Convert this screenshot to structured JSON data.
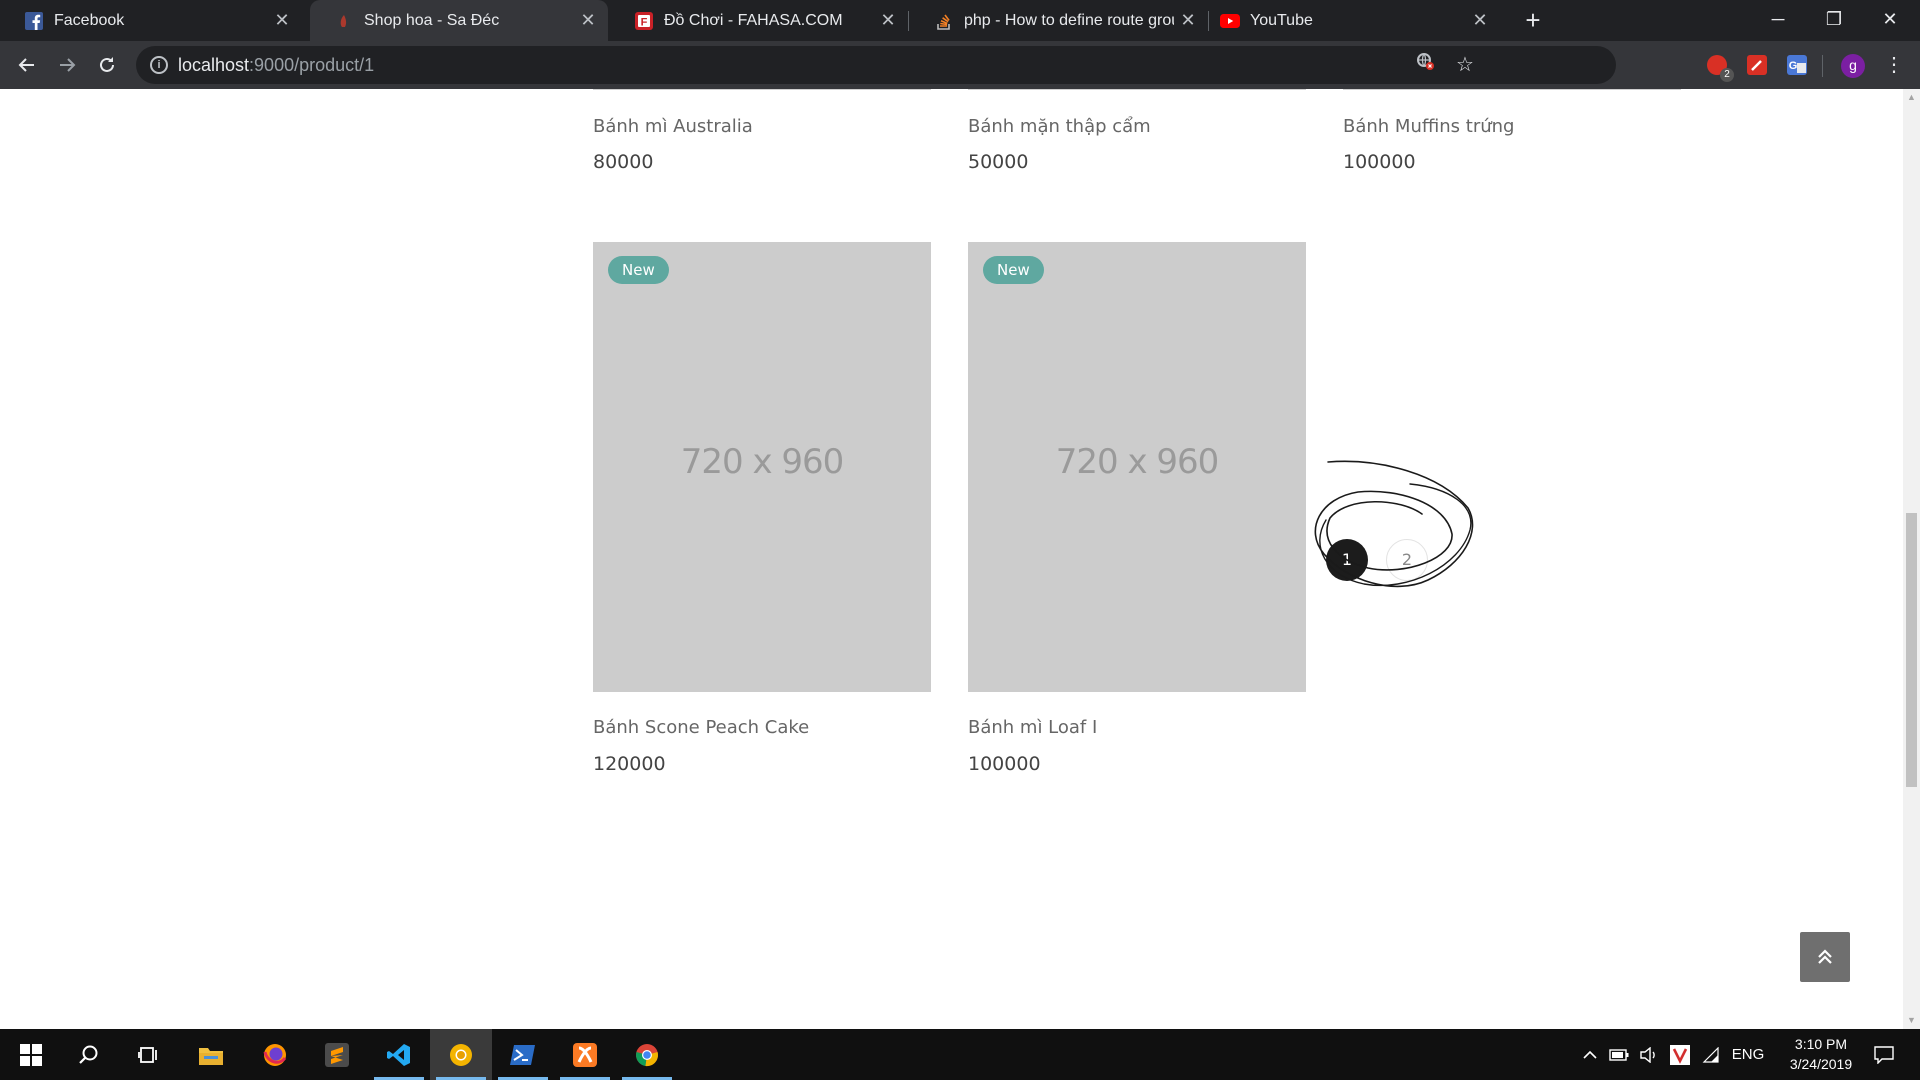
{
  "browser": {
    "tabs": [
      {
        "title": "Facebook",
        "icon": "facebook-icon",
        "active": false
      },
      {
        "title": "Shop hoa - Sa Đéc",
        "icon": "site-icon",
        "active": true
      },
      {
        "title": "Đồ Chơi - FAHASA.COM",
        "icon": "fahasa-icon",
        "active": false
      },
      {
        "title": "php - How to define route group",
        "icon": "stackoverflow-icon",
        "active": false
      },
      {
        "title": "YouTube",
        "icon": "youtube-icon",
        "active": false
      }
    ],
    "url_host": "localhost",
    "url_rest": ":9000/product/1",
    "extension_badge": "2",
    "profile_initial": "g"
  },
  "products_top": [
    {
      "name": "Bánh mì Australia",
      "price": "80000"
    },
    {
      "name": "Bánh mặn thập cẩm",
      "price": "50000"
    },
    {
      "name": "Bánh Muffins trứng",
      "price": "100000"
    }
  ],
  "products": [
    {
      "badge": "New",
      "image_text": "720 x 960",
      "name": "Bánh Scone Peach Cake",
      "price": "120000"
    },
    {
      "badge": "New",
      "image_text": "720 x 960",
      "name": "Bánh mì Loaf I",
      "price": "100000"
    }
  ],
  "pagination": {
    "pages": [
      "1",
      "2"
    ],
    "current": "1"
  },
  "scroll_top_icon": "double-chevron-up-icon",
  "taskbar": {
    "apps": [
      "windows-start-icon",
      "search-icon",
      "task-view-icon",
      "file-explorer-icon",
      "firefox-icon",
      "sublime-text-icon",
      "vscode-icon",
      "chrome-canary-icon",
      "powershell-icon",
      "xampp-icon",
      "chrome-icon"
    ],
    "language": "ENG",
    "time": "3:10 PM",
    "date": "3/24/2019"
  },
  "colors": {
    "badge": "#5fa8a0",
    "placeholder": "#cccccc",
    "page_active": "#1c1c1c",
    "chrome_dark": "#202124"
  }
}
